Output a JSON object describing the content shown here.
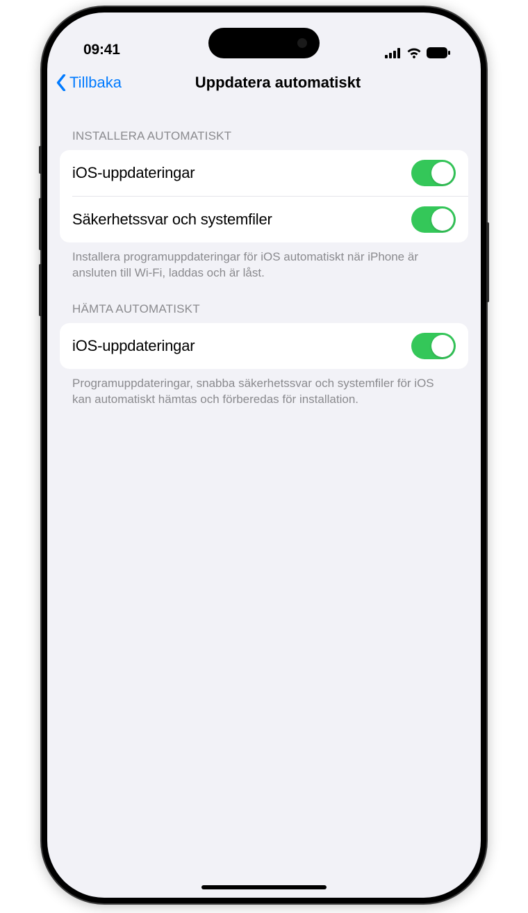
{
  "status": {
    "time": "09:41"
  },
  "nav": {
    "back_label": "Tillbaka",
    "title": "Uppdatera automatiskt"
  },
  "sections": {
    "install": {
      "header": "INSTALLERA AUTOMATISKT",
      "rows": {
        "ios_updates": {
          "label": "iOS-uppdateringar",
          "enabled": true
        },
        "security": {
          "label": "Säkerhetssvar och systemfiler",
          "enabled": true
        }
      },
      "footer": "Installera programuppdateringar för iOS automatiskt när iPhone är ansluten till Wi-Fi, laddas och är låst."
    },
    "download": {
      "header": "HÄMTA AUTOMATISKT",
      "rows": {
        "ios_updates": {
          "label": "iOS-uppdateringar",
          "enabled": true
        }
      },
      "footer": "Programuppdateringar, snabba säkerhetssvar och systemfiler för iOS kan automatiskt hämtas och förberedas för installation."
    }
  }
}
